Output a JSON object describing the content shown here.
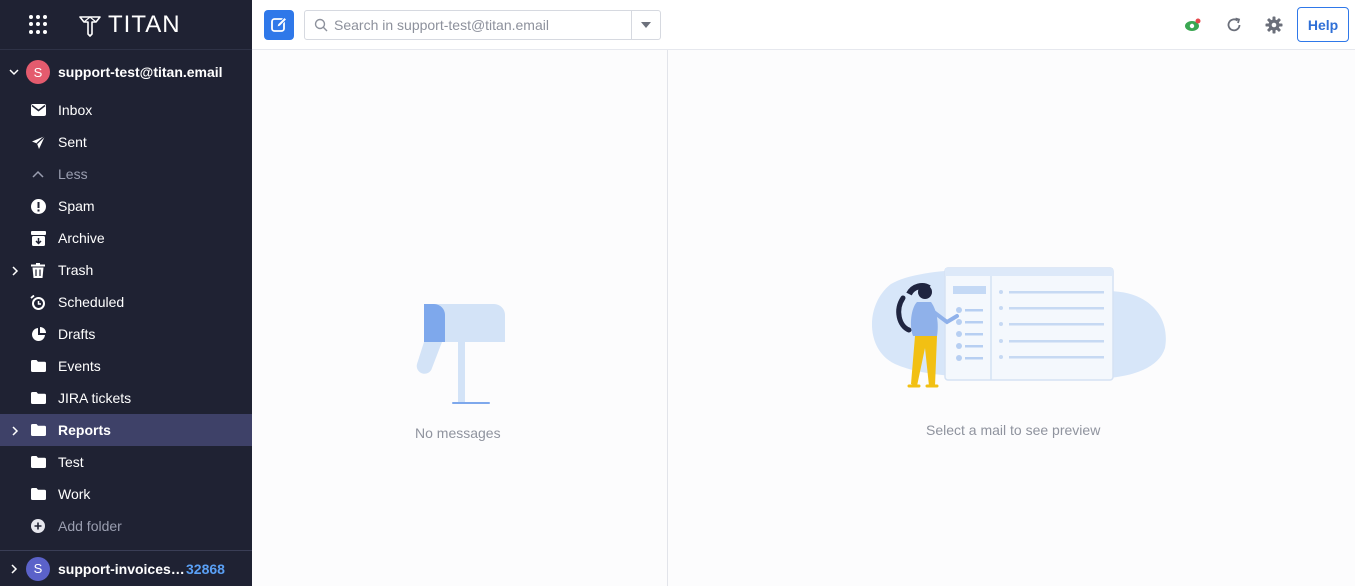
{
  "brand": {
    "logo_text": "TITAN"
  },
  "account": {
    "avatar_letter": "S",
    "email": "support-test@titan.email",
    "avatar_color": "#e45b6e"
  },
  "folders": [
    {
      "label": "Inbox",
      "icon": "inbox-icon"
    },
    {
      "label": "Sent",
      "icon": "send-icon"
    },
    {
      "label": "Less",
      "icon": "chevron-up-icon"
    },
    {
      "label": "Spam",
      "icon": "spam-icon"
    },
    {
      "label": "Archive",
      "icon": "archive-icon"
    },
    {
      "label": "Trash",
      "icon": "trash-icon"
    },
    {
      "label": "Scheduled",
      "icon": "clock-icon"
    },
    {
      "label": "Drafts",
      "icon": "drafts-icon"
    },
    {
      "label": "Events",
      "icon": "folder-icon"
    },
    {
      "label": "JIRA tickets",
      "icon": "folder-icon"
    },
    {
      "label": "Reports",
      "icon": "folder-icon"
    },
    {
      "label": "Test",
      "icon": "folder-icon"
    },
    {
      "label": "Work",
      "icon": "folder-icon"
    },
    {
      "label": "Add folder",
      "icon": "add-folder-icon"
    }
  ],
  "account2": {
    "avatar_letter": "S",
    "email": "support-invoices@fl...",
    "unread_count": "32868",
    "avatar_color": "#5b62c9"
  },
  "search": {
    "placeholder": "Search in support-test@titan.email"
  },
  "toolbar": {
    "help_label": "Help"
  },
  "message_list": {
    "empty_text": "No messages"
  },
  "preview": {
    "empty_text": "Select a mail to see preview"
  },
  "colors": {
    "sidebar_bg": "#1f2233",
    "accent": "#2f78e9",
    "active_folder_bg": "#3e4168"
  }
}
